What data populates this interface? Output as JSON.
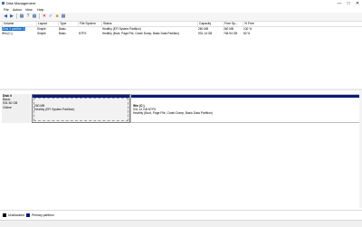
{
  "window": {
    "title": "Disk Management",
    "minimize": "—",
    "maximize": "□",
    "close": "✕"
  },
  "menu": [
    "File",
    "Action",
    "View",
    "Help"
  ],
  "toolbar": [
    "back-icon",
    "forward-icon",
    "properties-icon",
    "help-icon",
    "refresh-icon",
    "delete-icon",
    "check-icon",
    "new-icon",
    "open-icon"
  ],
  "volume_table": {
    "headers": [
      "Volume",
      "Layout",
      "Type",
      "File System",
      "Status",
      "Capacity",
      "Free Sp...",
      "% Free"
    ],
    "rows": [
      [
        "(Disk 0 partition 1)",
        "Simple",
        "Basic",
        "",
        "Healthy (EFI System Partition)",
        "260 MB",
        "260 MB",
        "100 %"
      ],
      [
        "Win (C:)",
        "Simple",
        "Basic",
        "NTFS",
        "Healthy (Boot, Page File, Crash Dump, Basic Data Partition)",
        "931.14 GB",
        "748.94 GB",
        "80 %"
      ]
    ]
  },
  "disk": {
    "name": "Disk 0",
    "type": "Basic",
    "size": "931.50 GB",
    "state": "Online",
    "partitions": [
      {
        "label": "",
        "size": "260 MB",
        "status": "Healthy (EFI System Partition)"
      },
      {
        "label": "Win (C:)",
        "size": "931.14 GB NTFS",
        "status": "Healthy (Boot, Page File, Crash Dump, Basic Data Partition)"
      }
    ]
  },
  "legend": [
    {
      "label": "Unallocated",
      "color": "#000000"
    },
    {
      "label": "Primary partition",
      "color": "#0a1a7a"
    }
  ],
  "colors": {
    "selection": "#0a6ad0",
    "partition_bar": "#0a1a7a"
  }
}
